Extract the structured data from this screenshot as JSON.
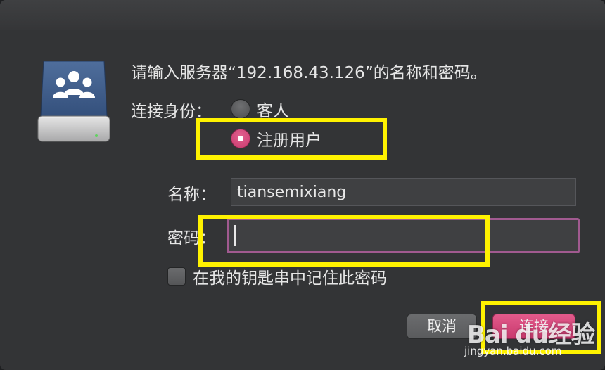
{
  "dialog": {
    "prompt": "请输入服务器“192.168.43.126”的名称和密码。",
    "connect_as_label": "连接身份：",
    "options": {
      "guest": "客人",
      "registered_user": "注册用户",
      "selected": "registered_user"
    },
    "fields": {
      "name_label": "名称：",
      "name_value": "tiansemixiang",
      "password_label": "密码：",
      "password_value": ""
    },
    "remember_keychain": {
      "label": "在我的钥匙串中记住此密码",
      "checked": false
    },
    "buttons": {
      "cancel": "取消",
      "connect": "连接"
    }
  },
  "icon": "network-server-drive-icon",
  "watermark": {
    "logo": "Bai du经验",
    "url": "jingyan.baidu.com"
  },
  "colors": {
    "accent": "#c93a6e",
    "focus_ring": "#a15a90",
    "annotation": "#fff200"
  }
}
